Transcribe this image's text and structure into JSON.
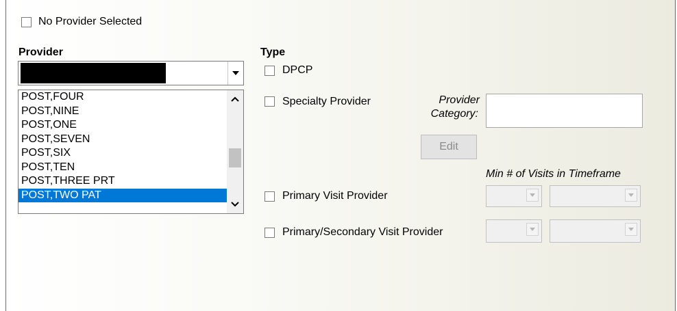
{
  "no_provider": {
    "label": "No Provider Selected",
    "checked": false
  },
  "provider": {
    "label": "Provider",
    "dropdown_value": "",
    "items": [
      "POST,FOUR",
      "POST,NINE",
      "POST,ONE",
      "POST,SEVEN",
      "POST,SIX",
      "POST,TEN",
      "POST,THREE PRT",
      "POST,TWO PAT"
    ],
    "selected_index": 7
  },
  "type": {
    "label": "Type",
    "dpcp": {
      "label": "DPCP",
      "checked": false
    },
    "specialty": {
      "label": "Specialty Provider",
      "checked": false
    },
    "provider_category_label_line1": "Provider",
    "provider_category_label_line2": "Category:",
    "provider_category_value": "",
    "edit_button": "Edit",
    "min_visits_label": "Min # of Visits in Timeframe",
    "primary_visit": {
      "label": "Primary Visit Provider",
      "checked": false
    },
    "primary_secondary_visit": {
      "label": "Primary/Secondary Visit Provider",
      "checked": false
    }
  },
  "colors": {
    "selection": "#0078d7",
    "redacted": "#000000"
  }
}
